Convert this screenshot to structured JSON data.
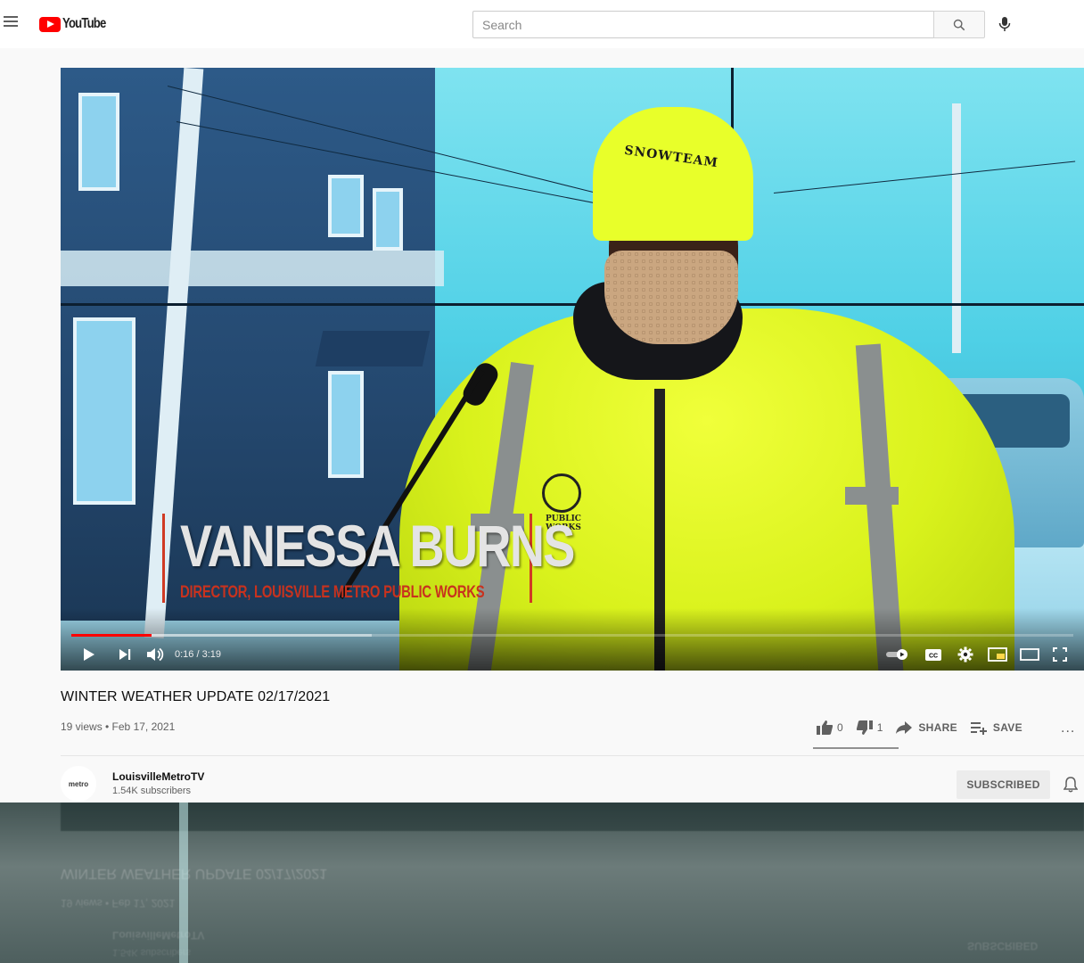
{
  "masthead": {
    "logo_text": "YouTube",
    "search_placeholder": "Search",
    "icons": {
      "menu": "menu-icon",
      "search": "search-icon",
      "mic": "mic-icon"
    }
  },
  "player": {
    "overlay": {
      "beanie_text": "SNOWTEAM",
      "name": "VANESSA BURNS",
      "role": "DIRECTOR, LOUISVILLE METRO PUBLIC WORKS",
      "seal_text": "PUBLIC WORKS"
    },
    "time_current": "0:16",
    "time_total": "3:19",
    "time_display": "0:16 / 3:19",
    "played_fraction": 0.08,
    "loaded_fraction": 0.3,
    "controls": [
      "play-icon",
      "next-icon",
      "volume-icon",
      "autoplay-toggle",
      "captions-icon",
      "settings-icon",
      "miniplayer-icon",
      "theater-icon",
      "fullscreen-icon"
    ],
    "colors": {
      "progress_played": "#ff0000"
    }
  },
  "video": {
    "title": "WINTER WEATHER UPDATE 02/17/2021",
    "meta": "19 views • Feb 17, 2021",
    "likes": "0",
    "dislikes": "1",
    "share_label": "SHARE",
    "save_label": "SAVE",
    "more_label": "..."
  },
  "owner": {
    "avatar_text": "metro",
    "name": "LouisvilleMetroTV",
    "subscribers": "1.54K subscribers",
    "subscribe_label": "SUBSCRIBED"
  }
}
